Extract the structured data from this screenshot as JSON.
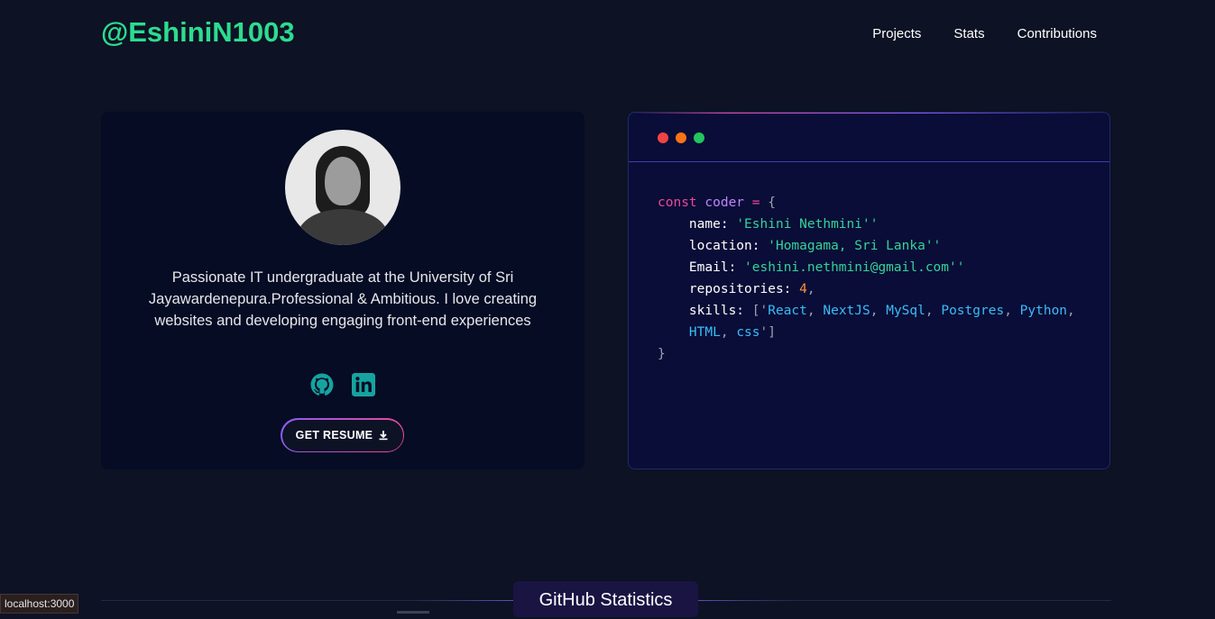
{
  "brand": "@EshiniN1003",
  "nav": [
    "Projects",
    "Stats",
    "Contributions"
  ],
  "profile": {
    "bio": "Passionate IT undergraduate at the University of Sri Jayawardenepura.Professional & Ambitious. I love creating websites and developing engaging front-end experiences",
    "resume_label": "GET RESUME"
  },
  "code": {
    "kw": "const",
    "var": "coder",
    "eq": "=",
    "open": "{",
    "close": "}",
    "name_key": "name:",
    "name_val": "'Eshini Nethmini''",
    "location_key": "location:",
    "location_val": "'Homagama, Sri Lanka''",
    "email_key": "Email:",
    "email_val": "'eshini.nethmini@gmail.com''",
    "repos_key": "repositories:",
    "repos_val": "4",
    "skills_key": "skills:",
    "skills": [
      "React",
      "NextJS",
      "MySql",
      "Postgres",
      "Python",
      "HTML",
      "css"
    ]
  },
  "github_stats_title": "GitHub Statistics",
  "status_url": "localhost:3000",
  "colors": {
    "background": "#0d1224",
    "brand": "#2ddc8f",
    "accent_pink": "#ec4899",
    "accent_purple": "#8b5cf6",
    "dot_red": "#ef4444",
    "dot_orange": "#f97316",
    "dot_green": "#22c55e",
    "social_icon": "#16a3a0"
  },
  "icons": [
    "github-icon",
    "linkedin-icon",
    "download-icon"
  ]
}
